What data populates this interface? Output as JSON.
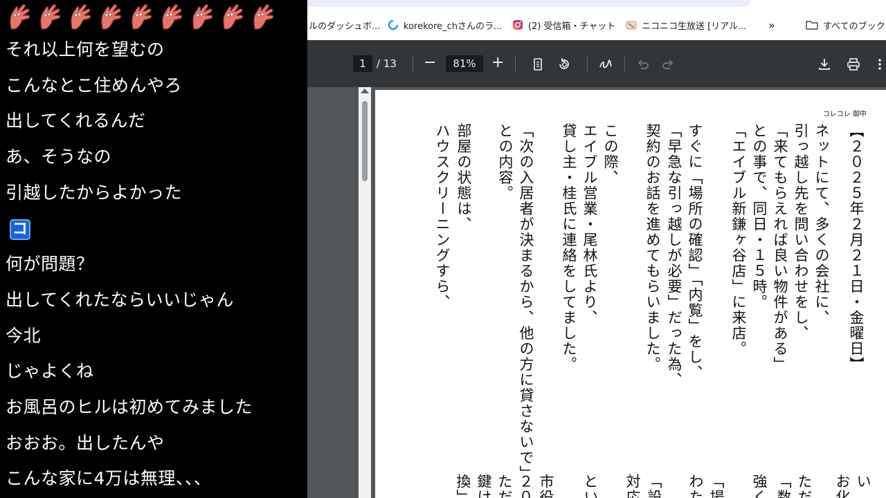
{
  "comments": {
    "stamp_count": 9,
    "lines": [
      "それ以上何を望むの",
      "こんなとこ住めんやろ",
      "出してくれるんだ",
      "あ、そうなの",
      "引越したからよかった",
      "",
      "何が問題？",
      "出してくれたならいいじゃん",
      "今北",
      "じゃよくね",
      "お風呂のヒルは初めてみました",
      "おおお。出したんや",
      "こんな家に4万は無理、、、"
    ],
    "badge_text": "コ",
    "badge_icon": "niconico-ko-badge-icon"
  },
  "bookmarks": [
    "ルのダッシュボ...",
    "korekore_chさんのラ...",
    "(2) 受信箱・チャット",
    "ニコニコ生放送 [リアル...",
    "»",
    "すべてのブックマ"
  ],
  "pdf_toolbar": {
    "page_current": "1",
    "page_total": "/ 13",
    "zoom": "81%",
    "minus": "−",
    "plus": "+"
  },
  "pdf_page": {
    "header": "コレコレ 御中",
    "columns": [
      "【２０２５年２月２１日・金曜日】",
      "ネットにて、多くの会社に、",
      "引っ越し先を問い合わせをし、",
      "「来てもらえれば良い物件がある」",
      "との事で、同日・１５時。",
      "「エイブル新鎌ヶ谷店」に来店。",
      "",
      "すぐに「場所の確認」「内覧」をし、",
      "「早急な引っ越しが必要」だった為、",
      "契約のお話を進めてもらいました。",
      "",
      "この際、",
      "エイブル営業・尾林氏より、",
      "貸し主・桂氏に連絡をしてました。",
      "",
      "「次の入居者が決まるから、他の方に貸さないで」",
      "との内容。",
      "",
      "部屋の状態は、",
      "ハウスクリーニングすら、"
    ],
    "bottom_fragments": [
      "い",
      "お化",
      "ただ",
      "「数",
      "強く",
      "「場",
      "わた",
      "「設",
      "対応",
      "とい",
      "市役",
      "２０",
      "ただ",
      "鍵け",
      "換」"
    ]
  }
}
